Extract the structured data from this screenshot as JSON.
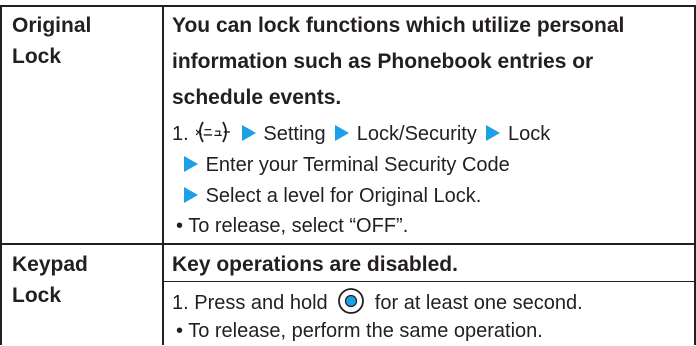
{
  "rows": [
    {
      "title_lines": [
        "Original",
        "Lock"
      ],
      "description_lines": [
        "You can lock functions which utilize personal",
        "information such as Phonebook entries or",
        "schedule events."
      ],
      "step": {
        "number": "1.",
        "menu_key_label": "メニュー",
        "path": [
          "Setting",
          "Lock/Security",
          "Lock"
        ],
        "line2": "Enter your Terminal Security Code",
        "line3": "Select a level for Original Lock."
      },
      "note": "• To release, select “OFF”."
    },
    {
      "title_lines": [
        "Keypad",
        "Lock"
      ],
      "description_lines": [
        "Key operations are disabled."
      ],
      "step": {
        "number": "1.",
        "before_key": "Press and hold",
        "after_key": "for at least one second."
      },
      "note": "• To release, perform the same operation."
    }
  ],
  "colors": {
    "arrow": "#1ca0e6",
    "text": "#231f20"
  }
}
